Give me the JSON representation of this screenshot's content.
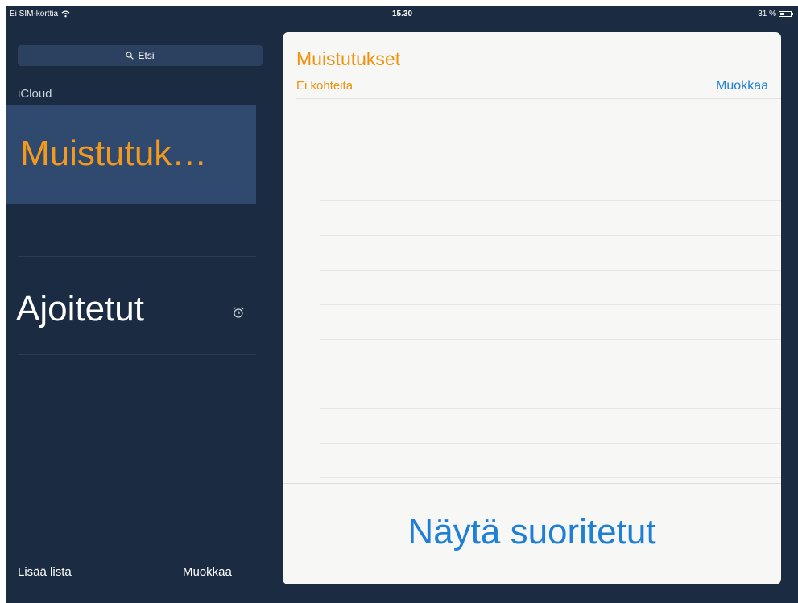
{
  "status_bar": {
    "carrier": "Ei SIM-korttia",
    "time": "15.30",
    "battery": "31 %"
  },
  "sidebar": {
    "search_placeholder": "Etsi",
    "account": "iCloud",
    "lists": [
      {
        "label": "Muistutuk…",
        "selected": true
      },
      {
        "label": "Ajoitetut",
        "icon": "alarm-clock-icon"
      }
    ],
    "footer": {
      "add_list": "Lisää lista",
      "edit": "Muokkaa"
    }
  },
  "detail": {
    "title": "Muistutukset",
    "subtitle": "Ei kohteita",
    "edit": "Muokkaa",
    "show_completed": "Näytä suoritetut"
  },
  "colors": {
    "sidebar_bg": "#1b2b42",
    "selected_bg": "#2f4a6e",
    "accent_orange": "#f0920e",
    "link_blue": "#1e7fd6"
  }
}
